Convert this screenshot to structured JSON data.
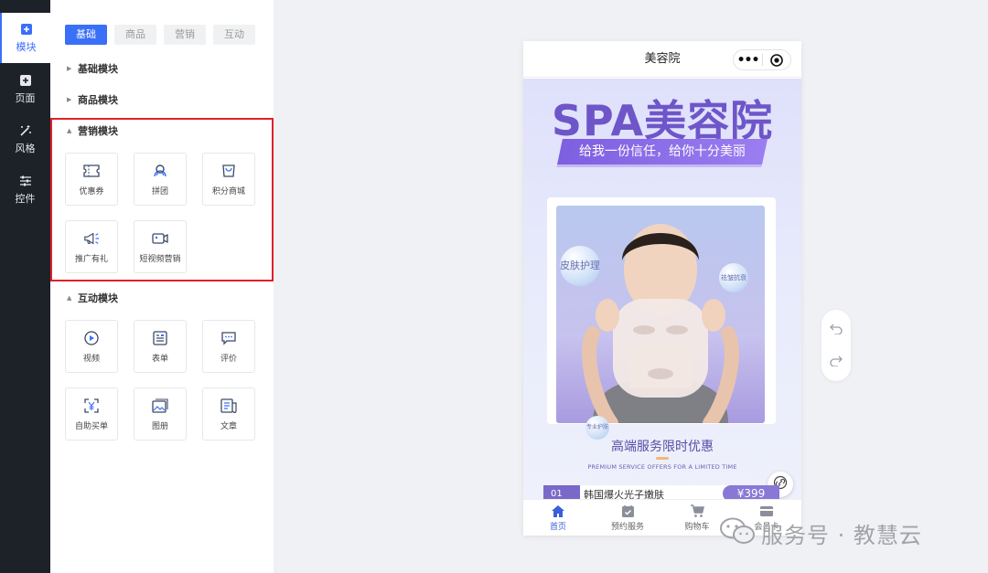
{
  "rail": {
    "items": [
      {
        "label": "模块",
        "icon": "plus-square-icon"
      },
      {
        "label": "页面",
        "icon": "plus-square-icon"
      },
      {
        "label": "风格",
        "icon": "magic-wand-icon"
      },
      {
        "label": "控件",
        "icon": "sliders-icon"
      }
    ],
    "active_index": 0
  },
  "panel": {
    "tabs": [
      "基础",
      "商品",
      "营销",
      "互动"
    ],
    "active_tab": 0,
    "sections": {
      "basic": {
        "title": "基础模块",
        "expanded": false
      },
      "goods": {
        "title": "商品模块",
        "expanded": false
      },
      "marketing": {
        "title": "营销模块",
        "expanded": true,
        "items": [
          {
            "label": "优惠券",
            "icon": "coupon-icon"
          },
          {
            "label": "拼团",
            "icon": "group-buy-icon"
          },
          {
            "label": "积分商城",
            "icon": "points-mall-icon"
          },
          {
            "label": "推广有礼",
            "icon": "megaphone-icon"
          },
          {
            "label": "短视频营销",
            "icon": "video-camera-icon"
          }
        ]
      },
      "interactive": {
        "title": "互动模块",
        "expanded": true,
        "items": [
          {
            "label": "视频",
            "icon": "play-circle-icon"
          },
          {
            "label": "表单",
            "icon": "form-icon"
          },
          {
            "label": "评价",
            "icon": "comment-icon"
          },
          {
            "label": "自助买单",
            "icon": "self-checkout-icon"
          },
          {
            "label": "图册",
            "icon": "album-icon"
          },
          {
            "label": "文章",
            "icon": "article-icon"
          }
        ]
      }
    },
    "highlight_color": "#e0202a"
  },
  "phone": {
    "title": "美容院",
    "capsule": {
      "more": "•••"
    },
    "banner": {
      "headline": "SPA美容院",
      "slogan": "给我一份信任，给你十分美丽",
      "bubbles": [
        "皮肤护理",
        "祛皱抗衰",
        "专业护肤"
      ],
      "offer_title": "高端服务限时优惠",
      "offer_subtitle": "PREMIUM SERVICE OFFERS FOR A LIMITED TIME"
    },
    "promo": {
      "badge": "01",
      "text": "韩国爆火光子嫩肤",
      "price": "¥399"
    },
    "tabbar": [
      {
        "label": "首页",
        "icon": "home-icon"
      },
      {
        "label": "预约服务",
        "icon": "calendar-check-icon"
      },
      {
        "label": "购物车",
        "icon": "cart-icon"
      },
      {
        "label": "会员卡",
        "icon": "member-card-icon"
      }
    ],
    "active_tab": 0
  },
  "history": {
    "undo": "undo-icon",
    "redo": "redo-icon"
  },
  "watermark": {
    "text": "服务号 · 教慧云",
    "icon": "wechat-icon"
  },
  "colors": {
    "accent": "#3a6ff7",
    "rail_bg": "#1d2128",
    "brand_purple": "#6e56c9"
  }
}
